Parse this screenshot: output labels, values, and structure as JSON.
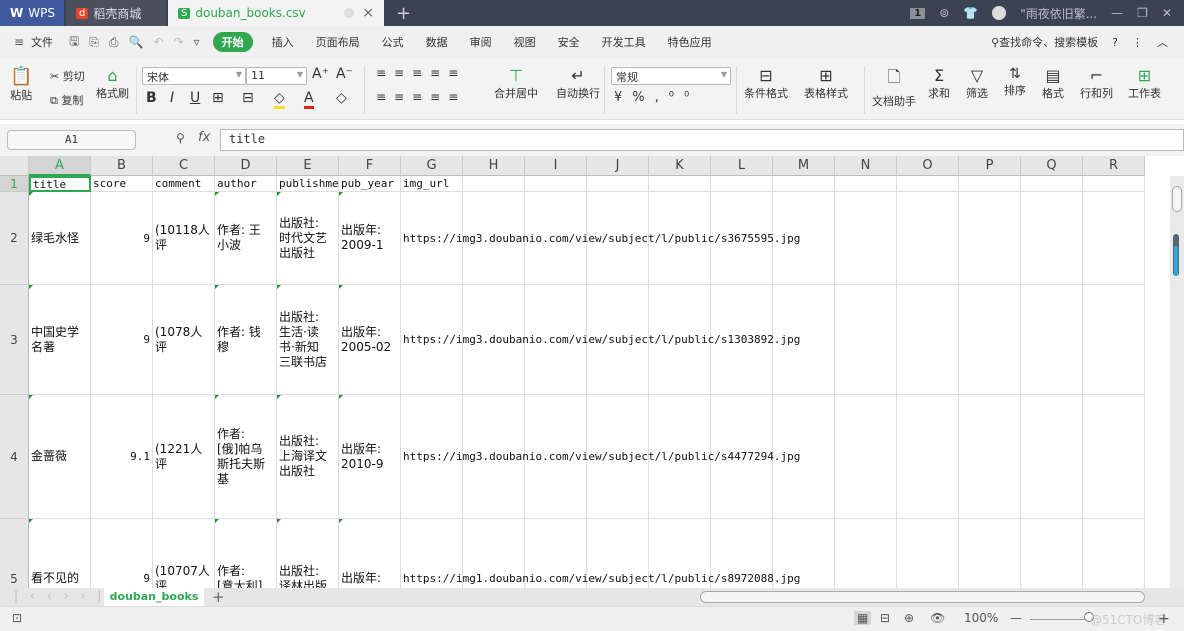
{
  "titlebar": {
    "app": "WPS",
    "store_tab": "稻壳商城",
    "file_tab": "douban_books.csv",
    "window_count": "1",
    "user": "\"雨夜依旧繁...",
    "new_tab": "+",
    "close": "×"
  },
  "menubar": {
    "file": "文件",
    "start": "开始",
    "items": [
      "插入",
      "页面布局",
      "公式",
      "数据",
      "审阅",
      "视图",
      "安全",
      "开发工具",
      "特色应用"
    ],
    "search": "查找命令、搜索模板",
    "help": "?"
  },
  "ribbon": {
    "paste": "粘贴",
    "cut": "剪切",
    "copy": "复制",
    "format_painter": "格式刷",
    "font_name": "宋体",
    "font_size": "11",
    "merge_center": "合并居中",
    "wrap_text": "自动换行",
    "number_format": "常规",
    "cond_format": "条件格式",
    "table_style": "表格样式",
    "doc_helper": "文档助手",
    "sum": "求和",
    "filter": "筛选",
    "sort": "排序",
    "format": "格式",
    "rows_cols": "行和列",
    "worksheet": "工作表"
  },
  "formula_bar": {
    "cell_ref": "A1",
    "fx": "fx",
    "content": "title"
  },
  "columns": [
    "A",
    "B",
    "C",
    "D",
    "E",
    "F",
    "G",
    "H",
    "I",
    "J",
    "K",
    "L",
    "M",
    "N",
    "O",
    "P",
    "Q",
    "R"
  ],
  "rows": [
    {
      "num": "1",
      "cells": [
        "title",
        "score",
        "comment",
        "author",
        "publishme",
        "pub_year",
        "img_url"
      ]
    },
    {
      "num": "2",
      "cells": [
        "绿毛水怪",
        "9",
        "(10118人评",
        "作者: 王\n小波",
        "出版社:\n时代文艺\n出版社",
        "出版年:\n2009-1",
        "https://img3.doubanio.com/view/subject/l/public/s3675595.jpg"
      ]
    },
    {
      "num": "3",
      "cells": [
        "中国史学\n名著",
        "9",
        "(1078人评",
        "作者: 钱\n穆",
        "出版社:\n生活·读\n书·新知\n三联书店",
        "出版年:\n2005-02",
        "https://img3.doubanio.com/view/subject/l/public/s1303892.jpg"
      ]
    },
    {
      "num": "4",
      "cells": [
        "金蔷薇",
        "9.1",
        "(1221人评",
        "作者:\n[俄]帕乌\n斯托夫斯\n基",
        "出版社:\n上海译文\n出版社",
        "出版年:\n2010-9",
        "https://img3.doubanio.com/view/subject/l/public/s4477294.jpg"
      ]
    },
    {
      "num": "5",
      "cells": [
        "看不见的",
        "9",
        "(10707人评",
        "作者:\n[意大利]",
        "出版社:\n译林出版",
        "出版年:",
        "https://img1.doubanio.com/view/subject/l/public/s8972088.jpg"
      ]
    }
  ],
  "sheets": {
    "active": "douban_books",
    "add": "+"
  },
  "status": {
    "zoom": "100%",
    "watermark": "@51CTO博客"
  }
}
